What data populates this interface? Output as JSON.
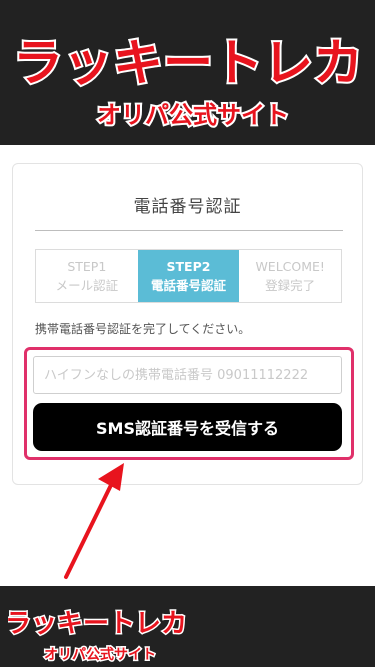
{
  "header": {
    "logo_main": "ラッキートレカ",
    "logo_sub": "オリパ公式サイト"
  },
  "card": {
    "title": "電話番号認証",
    "steps": [
      {
        "label": "STEP1",
        "sublabel": "メール認証",
        "active": false
      },
      {
        "label": "STEP2",
        "sublabel": "電話番号認証",
        "active": true
      },
      {
        "label": "WELCOME!",
        "sublabel": "登録完了",
        "active": false
      }
    ],
    "instruction": "携帯電話番号認証を完了してください。",
    "phone_placeholder": "ハイフンなしの携帯電話番号 09011112222",
    "submit_label": "SMS認証番号を受信する"
  },
  "footer": {
    "logo_main": "ラッキートレカ",
    "logo_sub": "オリパ公式サイト"
  },
  "colors": {
    "header_bg": "#222222",
    "active_step": "#5bbcd6",
    "button_bg": "#000000",
    "highlight": "#e0306a",
    "logo_red": "#e8141e"
  }
}
